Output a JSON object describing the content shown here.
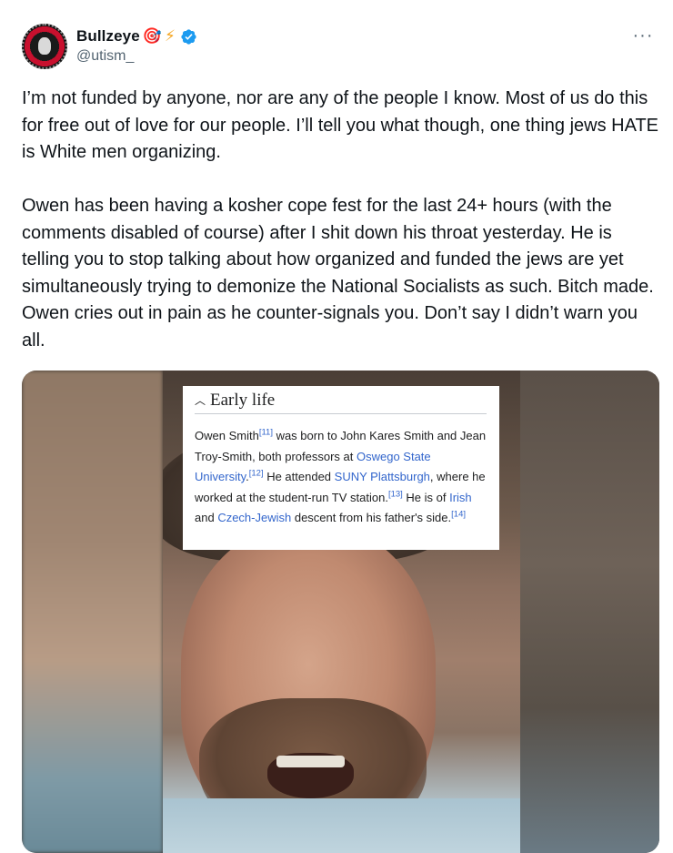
{
  "user": {
    "display_name": "Bullzeye",
    "emojis": [
      "🎯",
      "⚡"
    ],
    "handle": "@utism_"
  },
  "more_label": "···",
  "tweet_text": "I’m not funded by anyone, nor are any of the people I know. Most of us do this for free out of love for our people. I’ll tell you what though, one thing jews HATE is White men organizing.\n\nOwen has been having a kosher cope fest for the last 24+ hours (with the comments disabled of course) after I shit down his throat yesterday. He is telling you to stop talking about how organized and funded the jews are yet simultaneously trying to demonize the National Socialists as such. Bitch made. Owen cries out in pain as he counter-signals you. Don’t say I didn’t warn you all.",
  "wiki": {
    "heading": "Early life",
    "p1_a": "Owen Smith",
    "cite_11": "[11]",
    "p1_b": " was born to John Kares Smith and Jean Troy-Smith, both professors at ",
    "link_oswego": "Oswego State University",
    "p1_c": ".",
    "cite_12": "[12]",
    "p1_d": " He attended ",
    "link_suny": "SUNY Plattsburgh",
    "p1_e": ", where he worked at the student-run TV station.",
    "cite_13": "[13]",
    "p1_f": " He is of ",
    "link_irish": "Irish",
    "p1_g": " and ",
    "link_czech": "Czech-Jewish",
    "p1_h": " descent from his father's side.",
    "cite_14": "[14]"
  },
  "colors": {
    "text": "#0f1419",
    "secondary": "#536471",
    "verified": "#1d9bf0",
    "wiki_link": "#3366cc"
  },
  "icons": [
    "verified-badge-icon",
    "more-icon",
    "chevron-up-icon"
  ]
}
